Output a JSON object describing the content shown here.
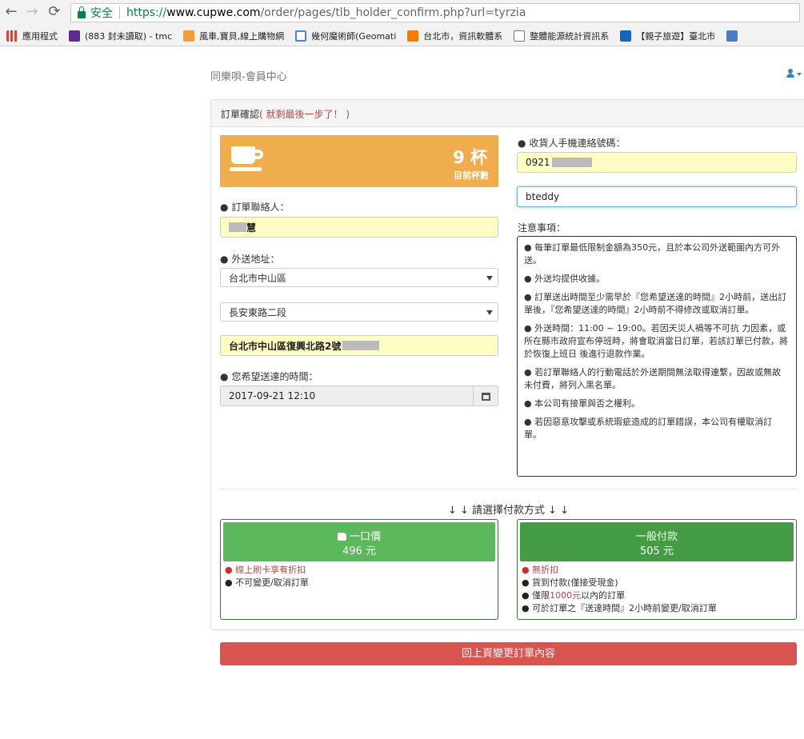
{
  "browser": {
    "secure_label": "安全",
    "url_scheme": "https://",
    "url_host": "www.cupwe.com",
    "url_path": "/order/pages/tlb_holder_confirm.php?url=tyrzia",
    "bookmarks": [
      {
        "label": "應用程式",
        "icon": "apps-icon"
      },
      {
        "label": "(883 封未讀取) - tmc",
        "icon": "mail-icon"
      },
      {
        "label": "風車,寶貝,線上購物網",
        "icon": "fox-icon"
      },
      {
        "label": "幾何魔術師(Geomati",
        "icon": "google-icon"
      },
      {
        "label": "台北市，資訊軟體系",
        "icon": "d4-icon"
      },
      {
        "label": "整體能源統計資訊系",
        "icon": "doc-icon"
      },
      {
        "label": "【親子旅遊】臺北市",
        "icon": "chat-icon"
      },
      {
        "label": "",
        "icon": "globe-icon"
      }
    ]
  },
  "header": {
    "brand": "同樂唄-會員中心"
  },
  "panel": {
    "title": "訂單確認",
    "hint": "( 就剩最後一步了！ )"
  },
  "cups": {
    "count": "9 杯",
    "label": "目前杯數"
  },
  "form": {
    "contact_label": "訂單聯絡人：",
    "contact_value": "慧",
    "address_label": "外送地址：",
    "district": "台北市中山區",
    "road": "長安東路二段",
    "address_detail": "台北市中山區復興北路2號",
    "time_label": "您希望送達的時間：",
    "time_value": "2017-09-21 12:10",
    "phone_label": "收貨人手機連絡號碼：",
    "phone_value": "0921",
    "name_value": "bteddy",
    "notice_label": "注意事項："
  },
  "notices": [
    "每筆訂單最低限制金額為350元，且於本公司外送範圍內方可外送。",
    "外送均提供收據。",
    "訂單送出時間至少需早於『您希望送達的時間』2小時前，送出訂單後，『您希望送達的時間』2小時前不得修改或取消訂單。",
    "外送時間：11:00 ~ 19:00。若因天災人禍等不可抗 力因素，或所在縣市政府宣布停班時，將會取消當日訂單，若該訂單已付款，將於恢復上班日 後進行退款作業。",
    "若訂單聯絡人的行動電話於外送期間無法取得連繫，因故或無故未付費，將列入黑名單。",
    "本公司有接單與否之權利。",
    "若因惡意攻擊或系統瑕疵造成的訂單錯誤，本公司有權取消訂單。"
  ],
  "payment": {
    "title": "↓ ↓ 請選擇付款方式 ↓ ↓",
    "flat": {
      "label": "一口價",
      "price": "496 元",
      "features": [
        "線上刷卡享有折扣",
        "不可變更/取消訂單"
      ]
    },
    "normal": {
      "label": "一般付款",
      "price": "505 元",
      "feature_1": "無折扣",
      "feature_2": "貨到付款(僅接受現金)",
      "feature_3_pre": "僅限",
      "feature_3_amount": "1000元",
      "feature_3_post": "以內的訂單",
      "feature_4": "可於訂單之『送達時間』2小時前變更/取消訂單"
    }
  },
  "back_button": "回上頁變更訂單內容"
}
